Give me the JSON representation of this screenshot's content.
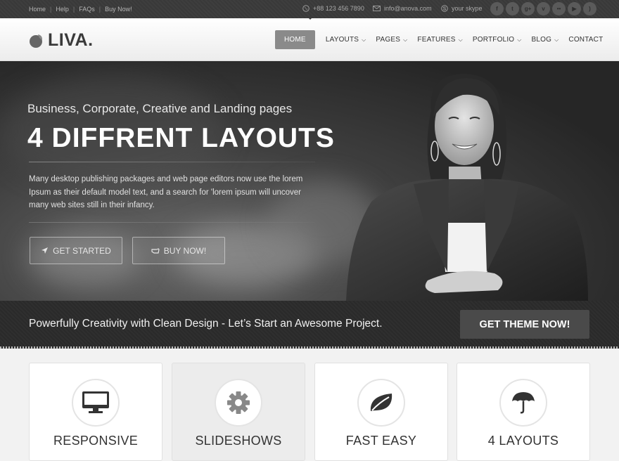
{
  "topbar": {
    "links": [
      "Home",
      "Help",
      "FAQs",
      "Buy Now!"
    ],
    "phone": "+88 123 456 7890",
    "email": "info@anova.com",
    "skype": "your skype",
    "socials": [
      "facebook-icon",
      "twitter-icon",
      "google-plus-icon",
      "vimeo-icon",
      "flickr-icon",
      "youtube-icon",
      "rss-icon"
    ]
  },
  "header": {
    "logo": "LIVA.",
    "menu": [
      {
        "label": "HOME",
        "active": true,
        "dropdown": false
      },
      {
        "label": "LAYOUTS",
        "dropdown": true
      },
      {
        "label": "PAGES",
        "dropdown": true
      },
      {
        "label": "FEATURES",
        "dropdown": true
      },
      {
        "label": "PORTFOLIO",
        "dropdown": true
      },
      {
        "label": "BLOG",
        "dropdown": true
      },
      {
        "label": "CONTACT",
        "dropdown": false
      }
    ]
  },
  "hero": {
    "subtitle": "Business, Corporate, Creative and Landing pages",
    "title": "4 DIFFRENT LAYOUTS",
    "text": "Many desktop publishing packages and web page editors now use the lorem Ipsum as their default model text, and a search for 'lorem ipsum will uncover many web sites still in their infancy.",
    "btn_start": "GET STARTED",
    "btn_buy": "BUY NOW!"
  },
  "cta": {
    "text": "Powerfully Creativity with Clean Design - Let’s Start an Awesome Project.",
    "button": "GET THEME NOW!"
  },
  "features": [
    {
      "title": "RESPONSIVE",
      "icon": "monitor-icon"
    },
    {
      "title": "SLIDESHOWS",
      "icon": "gear-icon"
    },
    {
      "title": "FAST EASY",
      "icon": "leaf-icon"
    },
    {
      "title": "4 LAYOUTS",
      "icon": "umbrella-icon"
    }
  ],
  "colors": {
    "accent": "#8a8a8a",
    "dark": "#2b2b2b",
    "topbar": "#3a3a3a"
  }
}
